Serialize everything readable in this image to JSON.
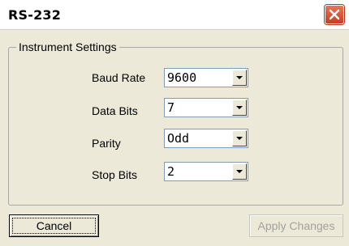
{
  "window": {
    "title": "RS-232"
  },
  "group": {
    "label": "Instrument Settings"
  },
  "fields": [
    {
      "label": "Baud Rate",
      "value": "9600"
    },
    {
      "label": "Data Bits",
      "value": "7"
    },
    {
      "label": "Parity",
      "value": "Odd"
    },
    {
      "label": "Stop Bits",
      "value": "2"
    }
  ],
  "buttons": {
    "cancel": "Cancel",
    "apply": "Apply Changes"
  },
  "colors": {
    "dialog_bg": "#ece9d8",
    "close_button": "#d4532f",
    "disabled_text": "#a3a29c"
  }
}
